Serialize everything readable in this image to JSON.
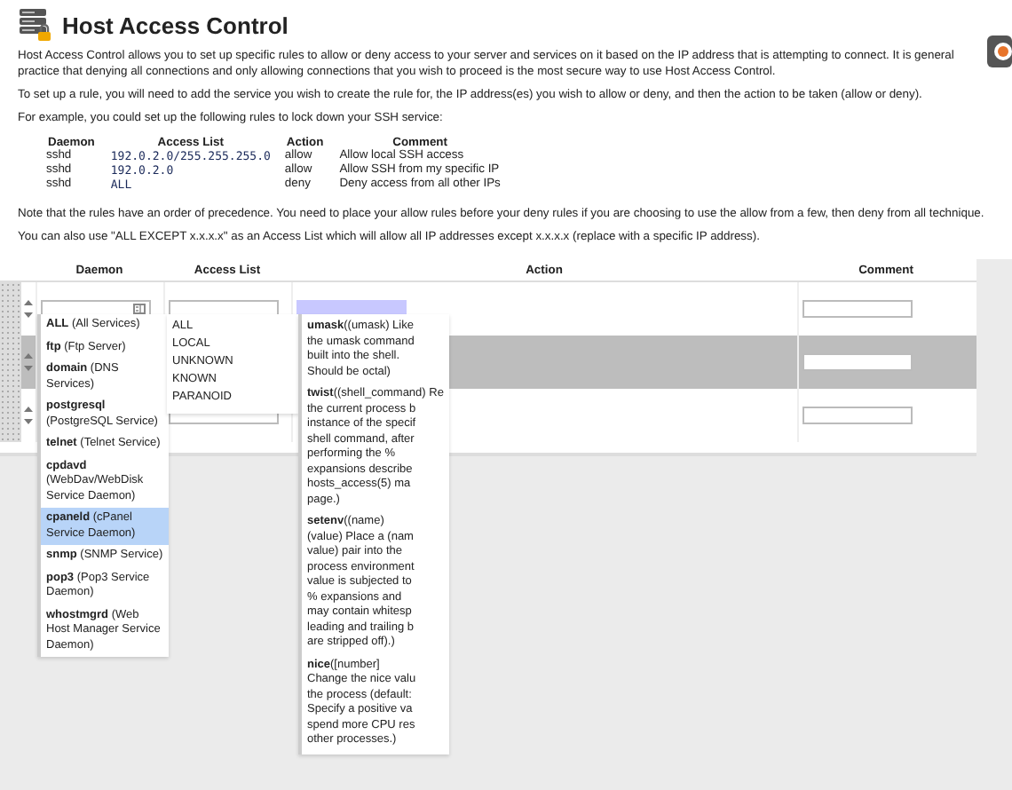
{
  "header": {
    "title": "Host Access Control"
  },
  "intro": [
    "Host Access Control allows you to set up specific rules to allow or deny access to your server and services on it based on the IP address that is attempting to connect. It is general practice that denying all connections and only allowing connections that you wish to proceed is the most secure way to use Host Access Control.",
    "To set up a rule, you will need to add the service you wish to create the rule for, the IP address(es) you wish to allow or deny, and then the action to be taken (allow or deny).",
    "For example, you could set up the following rules to lock down your SSH service:"
  ],
  "example": {
    "columns": [
      "Daemon",
      "Access List",
      "Action",
      "Comment"
    ],
    "rows": [
      [
        "sshd",
        "192.0.2.0/255.255.255.0",
        "allow",
        "Allow local SSH access"
      ],
      [
        "sshd",
        "192.0.2.0",
        "allow",
        "Allow SSH from my specific IP"
      ],
      [
        "sshd",
        "ALL",
        "deny",
        "Deny access from all other IPs"
      ]
    ]
  },
  "notes": [
    "Note that the rules have an order of precedence. You need to place your allow rules before your deny rules if you are choosing to use the allow from a few, then deny from all technique.",
    "You can also use \"ALL EXCEPT x.x.x.x\" as an Access List which will allow all IP addresses except x.x.x.x (replace with a specific IP address)."
  ],
  "rules_table": {
    "columns": [
      "Daemon",
      "Access List",
      "Action",
      "Comment"
    ],
    "rows": [
      {
        "selected": false
      },
      {
        "selected": true
      },
      {
        "selected": false
      }
    ]
  },
  "daemon_options": [
    {
      "name": "ALL",
      "description": "(All Services)",
      "selected": false
    },
    {
      "name": "ftp",
      "description": "(Ftp Server)",
      "selected": false
    },
    {
      "name": "domain",
      "description": "(DNS Services)",
      "selected": false
    },
    {
      "name": "postgresql",
      "description": "(PostgreSQL Service)",
      "selected": false
    },
    {
      "name": "telnet",
      "description": "(Telnet Service)",
      "selected": false
    },
    {
      "name": "cpdavd",
      "description": "(WebDav/WebDisk Service Daemon)",
      "selected": false
    },
    {
      "name": "cpaneld",
      "description": "(cPanel Service Daemon)",
      "selected": true
    },
    {
      "name": "snmp",
      "description": "(SNMP Service)",
      "selected": false
    },
    {
      "name": "pop3",
      "description": "(Pop3 Service Daemon)",
      "selected": false
    },
    {
      "name": "whostmgrd",
      "description": "(Web Host Manager Service Daemon)",
      "selected": false
    }
  ],
  "access_list_options": [
    "ALL",
    "LOCAL",
    "UNKNOWN",
    "KNOWN",
    "PARANOID"
  ],
  "action_options": [
    {
      "name": "umask",
      "lines": [
        "((umask) Like",
        "the umask command",
        "built into the shell.",
        "Should be octal)"
      ]
    },
    {
      "name": "twist",
      "lines": [
        "((shell_command) Re",
        "the current process b",
        "instance of the specif",
        "shell command, after",
        "performing the %",
        "expansions describe",
        "hosts_access(5) ma",
        "page.)"
      ]
    },
    {
      "name": "setenv",
      "lines": [
        "((name)",
        "(value) Place a (nam",
        "value) pair into the",
        "process environment",
        "value is subjected to",
        "% expansions and",
        "may contain whitesp",
        "leading and trailing b",
        "are stripped off).)"
      ]
    },
    {
      "name": "nice",
      "lines": [
        "([number]",
        "Change the nice valu",
        "the process (default:",
        "Specify a positive va",
        "spend more CPU res",
        "other processes.)"
      ]
    }
  ]
}
